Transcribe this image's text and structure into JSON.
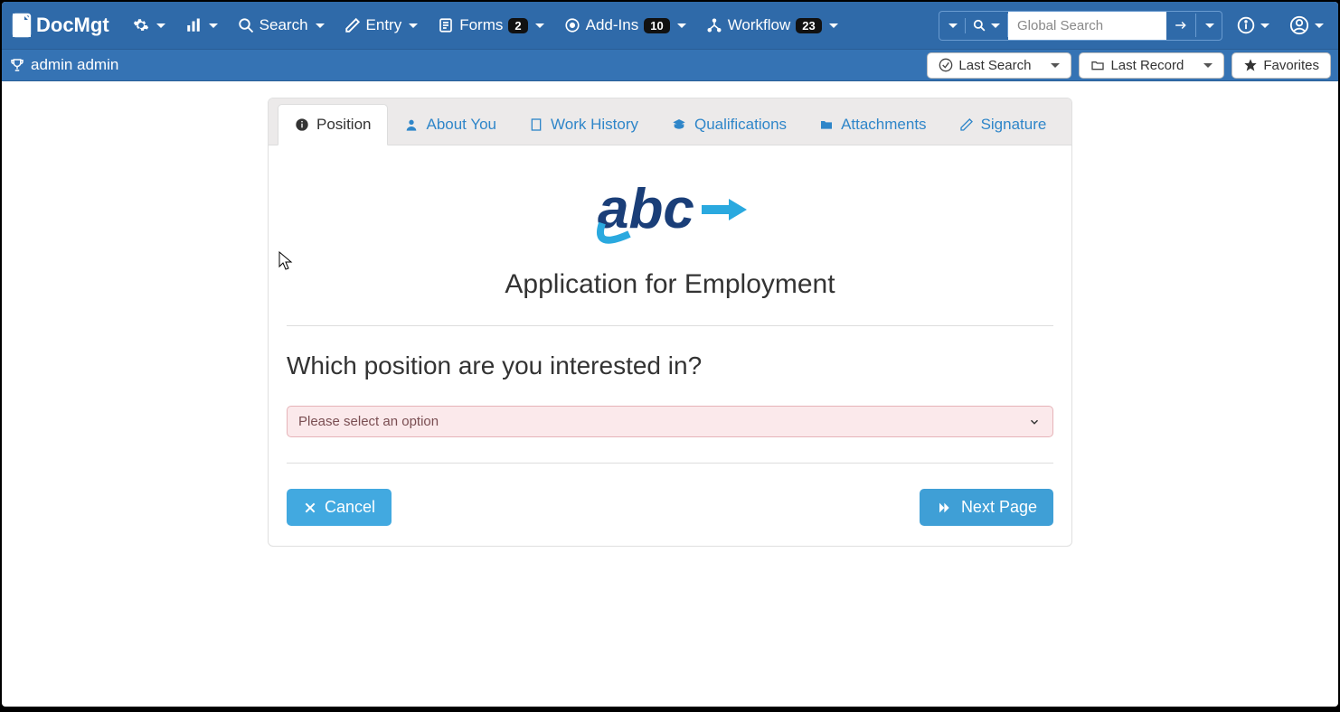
{
  "app": {
    "name": "DocMgt"
  },
  "topmenu": {
    "search": "Search",
    "entry": "Entry",
    "forms": "Forms",
    "forms_badge": "2",
    "addins": "Add-Ins",
    "addins_badge": "10",
    "workflow": "Workflow",
    "workflow_badge": "23"
  },
  "search": {
    "placeholder": "Global Search"
  },
  "subbar": {
    "user": "admin admin",
    "last_search": "Last Search",
    "last_record": "Last Record",
    "favorites": "Favorites"
  },
  "tabs": [
    {
      "label": "Position"
    },
    {
      "label": "About You"
    },
    {
      "label": "Work History"
    },
    {
      "label": "Qualifications"
    },
    {
      "label": "Attachments"
    },
    {
      "label": "Signature"
    }
  ],
  "form": {
    "title": "Application for Employment",
    "question": "Which position are you interested in?",
    "select_placeholder": "Please select an option",
    "cancel": "Cancel",
    "next": "Next Page"
  }
}
